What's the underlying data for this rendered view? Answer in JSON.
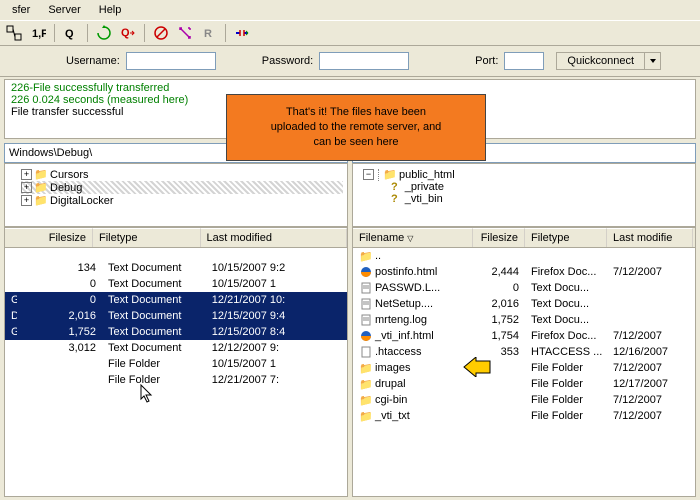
{
  "menu": {
    "transfer": "sfer",
    "server": "Server",
    "help": "Help"
  },
  "toolbar": {
    "icons": [
      "site-manager",
      "quick-toggle",
      "queue",
      "refresh",
      "upload-queue",
      "cancel",
      "process",
      "reconnect",
      "disconnect"
    ]
  },
  "connbar": {
    "username_label": "Username:",
    "password_label": "Password:",
    "port_label": "Port:",
    "quickconnect": "Quickconnect",
    "username": "",
    "password": "",
    "port": ""
  },
  "log": {
    "l1": "226-File successfully transferred",
    "l2": "226 0.024 seconds (measured here)",
    "l3": "File transfer successful"
  },
  "overlay": {
    "line1": "That's it! The files have been",
    "line2": "uploaded to the remote server, and",
    "line3": "can be seen here"
  },
  "paths": {
    "local": "Windows\\Debug\\",
    "remote": ""
  },
  "tree_local": {
    "i1": "Cursors",
    "i2": "Debug",
    "i3": "DigitalLocker"
  },
  "tree_remote": {
    "root": "public_html",
    "c1": "_private",
    "c2": "_vti_bin"
  },
  "local_cols": {
    "size": "Filesize",
    "type": "Filetype",
    "mod": "Last modified"
  },
  "remote_cols": {
    "name": "Filename",
    "size": "Filesize",
    "type": "Filetype",
    "mod": "Last modifie"
  },
  "local_rows": [
    {
      "name": "",
      "size": "134",
      "type": "Text Document",
      "mod": "10/15/2007 9:2",
      "sel": false,
      "icon": "file"
    },
    {
      "name": "",
      "size": "0",
      "type": "Text Document",
      "mod": "10/15/2007 1",
      "sel": false,
      "icon": "file"
    },
    {
      "name": "G",
      "size": "0",
      "type": "Text Document",
      "mod": "12/21/2007 10:",
      "sel": true,
      "icon": "file"
    },
    {
      "name": "DG",
      "size": "2,016",
      "type": "Text Document",
      "mod": "12/15/2007 9:4",
      "sel": true,
      "icon": "file"
    },
    {
      "name": "G",
      "size": "1,752",
      "type": "Text Document",
      "mod": "12/15/2007 8:4",
      "sel": true,
      "icon": "file"
    },
    {
      "name": "",
      "size": "3,012",
      "type": "Text Document",
      "mod": "12/12/2007 9:",
      "sel": false,
      "icon": "file"
    },
    {
      "name": "",
      "size": "",
      "type": "File Folder",
      "mod": "10/15/2007 1",
      "sel": false,
      "icon": "folder"
    },
    {
      "name": "",
      "size": "",
      "type": "File Folder",
      "mod": "12/21/2007 7:",
      "sel": false,
      "icon": "folder"
    }
  ],
  "remote_rows": [
    {
      "name": "..",
      "size": "",
      "type": "",
      "mod": "",
      "icon": "up"
    },
    {
      "name": "postinfo.html",
      "size": "2,444",
      "type": "Firefox Doc...",
      "mod": "7/12/2007",
      "icon": "firefox"
    },
    {
      "name": "PASSWD.L...",
      "size": "0",
      "type": "Text Docu...",
      "mod": "",
      "icon": "text"
    },
    {
      "name": "NetSetup....",
      "size": "2,016",
      "type": "Text Docu...",
      "mod": "",
      "icon": "text"
    },
    {
      "name": "mrteng.log",
      "size": "1,752",
      "type": "Text Docu...",
      "mod": "",
      "icon": "text"
    },
    {
      "name": "_vti_inf.html",
      "size": "1,754",
      "type": "Firefox Doc...",
      "mod": "7/12/2007",
      "icon": "firefox"
    },
    {
      "name": ".htaccess",
      "size": "353",
      "type": "HTACCESS ...",
      "mod": "12/16/2007",
      "icon": "file"
    },
    {
      "name": "images",
      "size": "",
      "type": "File Folder",
      "mod": "7/12/2007",
      "icon": "folder"
    },
    {
      "name": "drupal",
      "size": "",
      "type": "File Folder",
      "mod": "12/17/2007",
      "icon": "folder"
    },
    {
      "name": "cgi-bin",
      "size": "",
      "type": "File Folder",
      "mod": "7/12/2007",
      "icon": "folder"
    },
    {
      "name": "_vti_txt",
      "size": "",
      "type": "File Folder",
      "mod": "7/12/2007",
      "icon": "folder"
    }
  ]
}
